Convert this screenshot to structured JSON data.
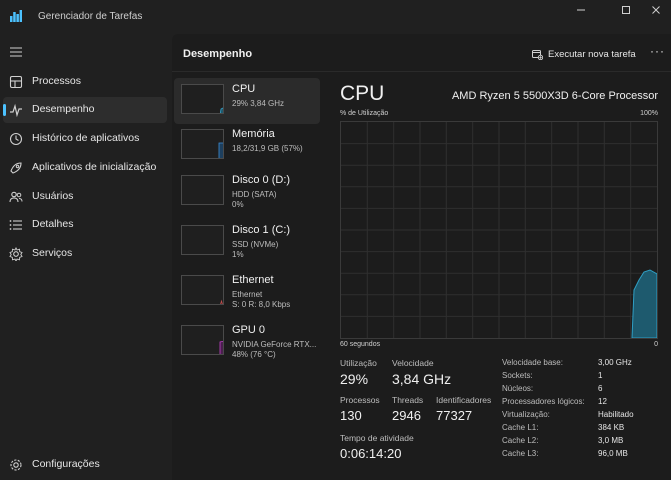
{
  "window": {
    "title": "Gerenciador de Tarefas"
  },
  "sidebar": {
    "items": [
      {
        "label": "Processos",
        "icon": "grid-icon"
      },
      {
        "label": "Desempenho",
        "icon": "performance-icon"
      },
      {
        "label": "Histórico de aplicativos",
        "icon": "history-icon"
      },
      {
        "label": "Aplicativos de inicialização",
        "icon": "startup-icon"
      },
      {
        "label": "Usuários",
        "icon": "users-icon"
      },
      {
        "label": "Detalhes",
        "icon": "details-icon"
      },
      {
        "label": "Serviços",
        "icon": "services-icon"
      }
    ],
    "settings_label": "Configurações"
  },
  "header": {
    "title": "Desempenho",
    "run_task_label": "Executar nova tarefa",
    "more_label": "···"
  },
  "resources": [
    {
      "name": "CPU",
      "line1": "29% 3,84 GHz",
      "line2": "",
      "color": "#38a0c8",
      "usage": 0.29
    },
    {
      "name": "Memória",
      "line1": "18,2/31,9 GB (57%)",
      "line2": "",
      "color": "#3c8fd8",
      "usage": 0.57
    },
    {
      "name": "Disco 0 (D:)",
      "line1": "HDD (SATA)",
      "line2": "0%",
      "color": "#6fbf4a",
      "usage": 0.0
    },
    {
      "name": "Disco 1 (C:)",
      "line1": "SSD (NVMe)",
      "line2": "1%",
      "color": "#6fbf4a",
      "usage": 0.01
    },
    {
      "name": "Ethernet",
      "line1": "Ethernet",
      "line2": "S: 0 R: 8,0 Kbps",
      "color": "#c05050",
      "usage": 0.05
    },
    {
      "name": "GPU 0",
      "line1": "NVIDIA GeForce RTX...",
      "line2": "48% (76 °C)",
      "color": "#c040c8",
      "usage": 0.48
    }
  ],
  "cpu": {
    "title": "CPU",
    "model": "AMD Ryzen 5 5500X3D 6-Core Processor",
    "graph_label": "% de Utilização",
    "graph_max": "100%",
    "graph_time": "60 segundos",
    "graph_min": "0",
    "graph_color": "#1e5a6e",
    "graph_line": "#2f9fc4",
    "stats": {
      "utilizacao_label": "Utilização",
      "utilizacao": "29%",
      "velocidade_label": "Velocidade",
      "velocidade": "3,84 GHz",
      "processos_label": "Processos",
      "processos": "130",
      "threads_label": "Threads",
      "threads": "2946",
      "identificadores_label": "Identificadores",
      "identificadores": "77327",
      "tempo_label": "Tempo de atividade",
      "tempo": "0:06:14:20"
    },
    "specs": [
      {
        "label": "Velocidade base:",
        "value": "3,00 GHz"
      },
      {
        "label": "Sockets:",
        "value": "1"
      },
      {
        "label": "Núcleos:",
        "value": "6"
      },
      {
        "label": "Processadores lógicos:",
        "value": "12"
      },
      {
        "label": "Virtualização:",
        "value": "Habilitado"
      },
      {
        "label": "Cache L1:",
        "value": "384 KB"
      },
      {
        "label": "Cache L2:",
        "value": "3,0 MB"
      },
      {
        "label": "Cache L3:",
        "value": "96,0 MB"
      }
    ]
  }
}
